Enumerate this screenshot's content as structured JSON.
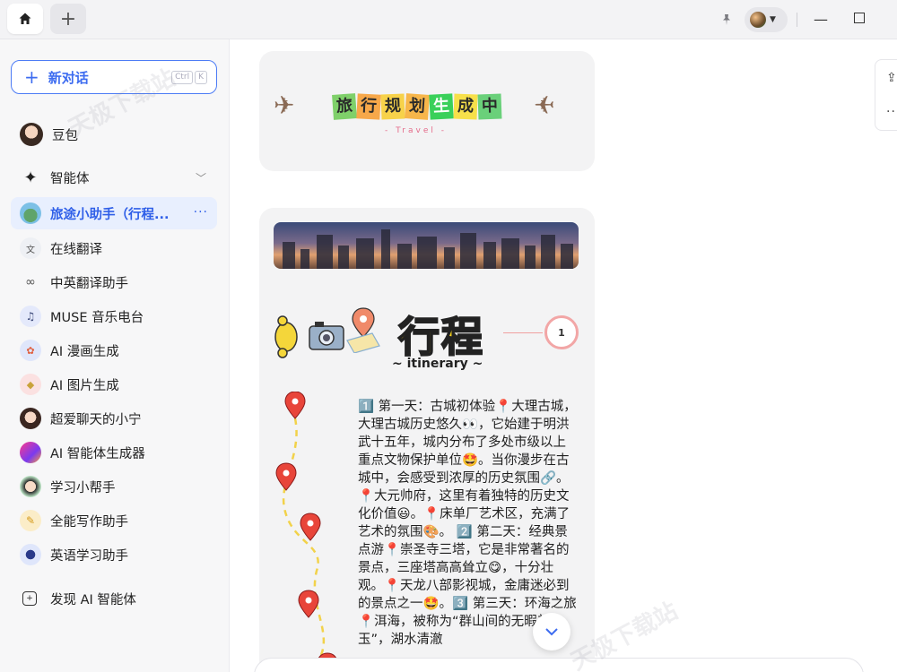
{
  "titlebar": {
    "home_icon": "home-icon",
    "plus_icon": "plus-icon",
    "pin_icon": "pin-icon",
    "minimize_icon": "minimize-icon",
    "maximize_icon": "maximize-icon"
  },
  "sidebar": {
    "new_chat_label": "新对话",
    "shortcut": [
      "Ctrl",
      "K"
    ],
    "items": [
      {
        "label": "豆包"
      },
      {
        "label": "智能体"
      },
      {
        "label": "旅途小助手（行程..."
      },
      {
        "label": "在线翻译"
      },
      {
        "label": "中英翻译助手"
      },
      {
        "label": "MUSE 音乐电台"
      },
      {
        "label": "AI 漫画生成"
      },
      {
        "label": "AI 图片生成"
      },
      {
        "label": "超爱聊天的小宁"
      },
      {
        "label": "AI 智能体生成器"
      },
      {
        "label": "学习小帮手"
      },
      {
        "label": "全能写作助手"
      },
      {
        "label": "英语学习助手"
      },
      {
        "label": "发现 AI 智能体"
      }
    ],
    "active_more": "···"
  },
  "main": {
    "banner": {
      "chars": [
        "旅",
        "行",
        "规",
        "划",
        "生",
        "成",
        "中"
      ],
      "subtitle": "- Travel -"
    },
    "itinerary": {
      "heading": "行程",
      "subheading": "~ itinerary ~",
      "step": "1",
      "text": "1️⃣ 第一天：古城初体验📍大理古城，大理古城历史悠久👀，它始建于明洪武十五年，城内分布了多处市级以上重点文物保护单位🤩。当你漫步在古城中，会感受到浓厚的历史氛围🔗。📍大元帅府，这里有着独特的历史文化价值😃。📍床单厂艺术区，充满了艺术的氛围🎨。 2️⃣ 第二天：经典景点游📍崇圣寺三塔，它是非常著名的景点，三座塔高高耸立😋，十分壮观。📍天龙八部影视城，金庸迷必到的景点之一🤩。3️⃣ 第三天：环海之旅📍洱海，被称为“群山间的无暇美玉”，湖水清澈"
    }
  },
  "watermarks": [
    "天极下载站",
    "天极下载站"
  ]
}
